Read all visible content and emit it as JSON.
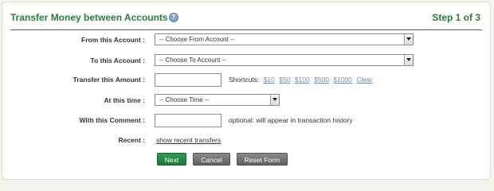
{
  "header": {
    "title": "Transfer Money between Accounts",
    "help_icon": "?",
    "step": "Step 1 of 3"
  },
  "form": {
    "from_account": {
      "label": "From this Account :",
      "selected": "-- Choose From Account --"
    },
    "to_account": {
      "label": "To this Account :",
      "selected": "-- Choose To Account --"
    },
    "amount": {
      "label": "Transfer this Amount :",
      "value": "",
      "shortcuts_label": "Shortcuts:",
      "shortcuts": [
        "$10",
        "$50",
        "$100",
        "$500",
        "$1000",
        "Clear"
      ]
    },
    "time": {
      "label": "At this time :",
      "selected": "-- Choose Time --"
    },
    "comment": {
      "label": "With this Comment :",
      "value": "",
      "hint": "optional: will appear in transaction history"
    },
    "recent": {
      "label": "Recent :",
      "link": "show recent transfers"
    }
  },
  "buttons": {
    "next": "Next",
    "cancel": "Cancel",
    "reset": "Reset Form"
  },
  "colors": {
    "title_green": "#2f7a3b",
    "next_button": "#1b7a3c",
    "secondary_button": "#6a6a6a",
    "link_blue": "#6e8fb5"
  }
}
